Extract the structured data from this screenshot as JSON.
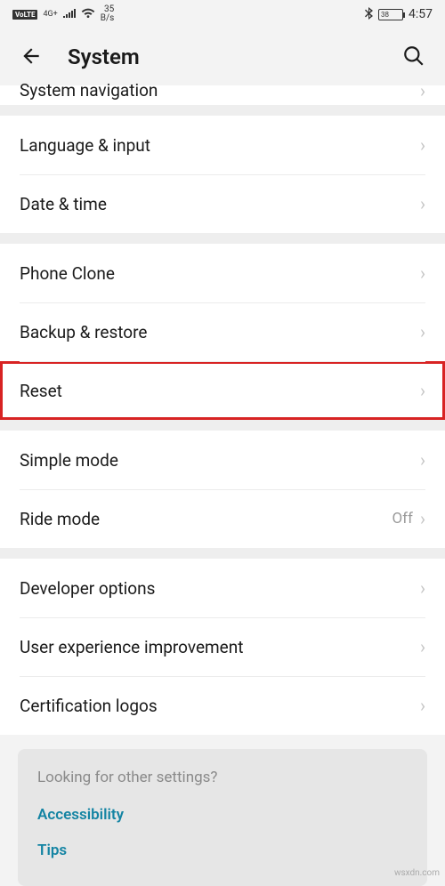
{
  "status_bar": {
    "volte": "VoLTE",
    "network_gen": "4G+",
    "net_speed_value": "35",
    "net_speed_unit": "B/s",
    "battery_pct": "38",
    "time": "4:57"
  },
  "header": {
    "title": "System"
  },
  "partial_top_item": {
    "label": "System navigation"
  },
  "groups": [
    {
      "items": [
        {
          "label": "Language & input"
        },
        {
          "label": "Date & time"
        }
      ]
    },
    {
      "items": [
        {
          "label": "Phone Clone"
        },
        {
          "label": "Backup & restore"
        },
        {
          "label": "Reset",
          "highlight": true
        }
      ]
    },
    {
      "items": [
        {
          "label": "Simple mode"
        },
        {
          "label": "Ride mode",
          "value": "Off"
        }
      ]
    },
    {
      "items": [
        {
          "label": "Developer options"
        },
        {
          "label": "User experience improvement"
        },
        {
          "label": "Certification logos"
        }
      ]
    }
  ],
  "more_settings": {
    "title": "Looking for other settings?",
    "links": [
      "Accessibility",
      "Tips"
    ]
  },
  "watermark": "wsxdn.com",
  "colors": {
    "highlight_border": "#d82323",
    "link_color": "#1484a3"
  }
}
